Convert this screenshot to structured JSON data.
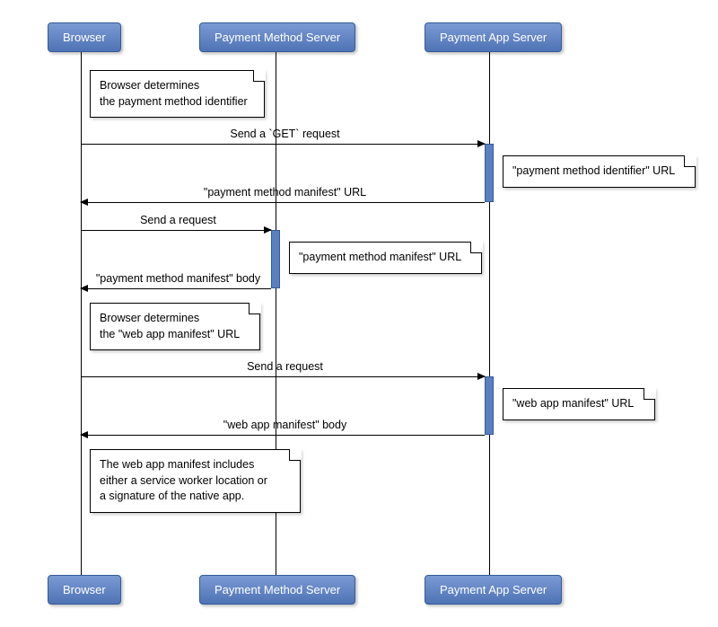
{
  "participants": {
    "browser": "Browser",
    "method_server": "Payment Method Server",
    "app_server": "Payment App Server"
  },
  "notes": {
    "n1_l1": "Browser determines",
    "n1_l2": "the payment method identifier",
    "n2": "\"payment method identifier\" URL",
    "n3": "\"payment method manifest\" URL",
    "n4_l1": "Browser determines",
    "n4_l2": "the \"web app manifest\" URL",
    "n5": "\"web app manifest\" URL",
    "n6_l1": "The web app manifest includes",
    "n6_l2": "either a service worker location or",
    "n6_l3": "a signature of the native app."
  },
  "messages": {
    "m1": "Send a `GET` request",
    "m2": "\"payment method manifest\" URL",
    "m3": "Send a request",
    "m4": "\"payment method manifest\" body",
    "m5": "Send a request",
    "m6": "\"web app manifest\" body"
  }
}
